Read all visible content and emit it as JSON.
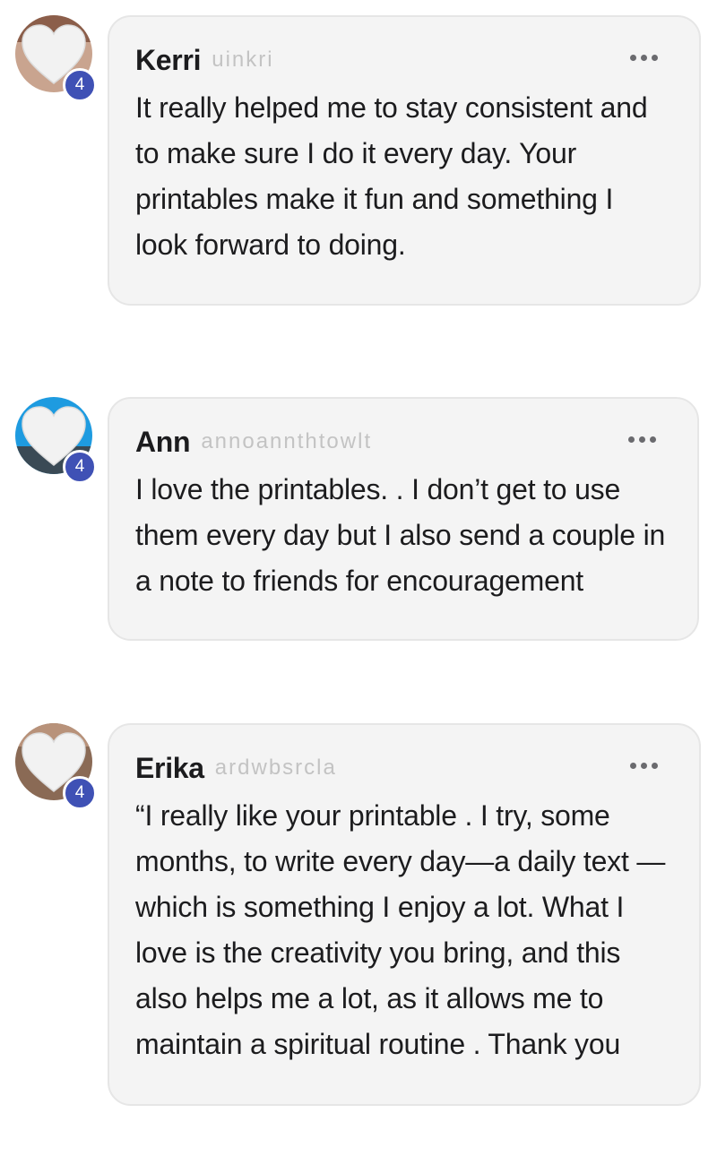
{
  "comments": [
    {
      "author": "Kerri",
      "author_meta": "uinkri",
      "badge": "4",
      "more_icon": "more-horizontal-icon",
      "avatar_icon": "heart-avatar",
      "avatar_bg": "#c9a48f",
      "text": "It really helped me to stay consistent and to make sure I do it every day. Your printables make it fun and something I look forward to doing."
    },
    {
      "author": "Ann",
      "author_meta": "annoannthtowlt",
      "badge": "4",
      "more_icon": "more-horizontal-icon",
      "avatar_icon": "heart-avatar",
      "avatar_bg": "#1e9be0",
      "text": "I love the printables. . I don’t get to use them every day but I also send a couple in a note to friends for encouragement"
    },
    {
      "author": "Erika",
      "author_meta": "ardwbsrcla",
      "badge": "4",
      "more_icon": "more-horizontal-icon",
      "avatar_icon": "heart-avatar",
      "avatar_bg": "#8a6a55",
      "text": "“I really like your printable . I try, some months, to write every day—a daily text —which is something I enjoy a lot. What I love is the creativity you bring, and this also helps me a lot, as it allows me to maintain a spiritual routine . Thank you"
    }
  ],
  "colors": {
    "badge": "#3f51b5",
    "bubble_bg": "#f4f4f4",
    "bubble_border": "#e6e6e6",
    "text": "#1c1c1e",
    "meta": "#c3c3c3"
  }
}
